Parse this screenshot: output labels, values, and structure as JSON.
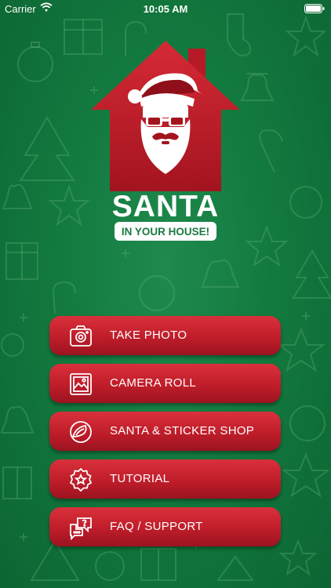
{
  "status_bar": {
    "carrier": "Carrier",
    "time": "10:05 AM"
  },
  "logo": {
    "title": "SANTA",
    "subtitle": "IN YOUR HOUSE!"
  },
  "menu": {
    "items": [
      {
        "label": "TAKE PHOTO",
        "icon": "camera-icon"
      },
      {
        "label": "CAMERA ROLL",
        "icon": "photo-gallery-icon"
      },
      {
        "label": "SANTA & STICKER SHOP",
        "icon": "shop-icon"
      },
      {
        "label": "TUTORIAL",
        "icon": "star-badge-icon"
      },
      {
        "label": "FAQ / SUPPORT",
        "icon": "chat-question-icon"
      }
    ]
  },
  "colors": {
    "background": "#137a3f",
    "button": "#c41f2c",
    "house": "#c9222e"
  }
}
